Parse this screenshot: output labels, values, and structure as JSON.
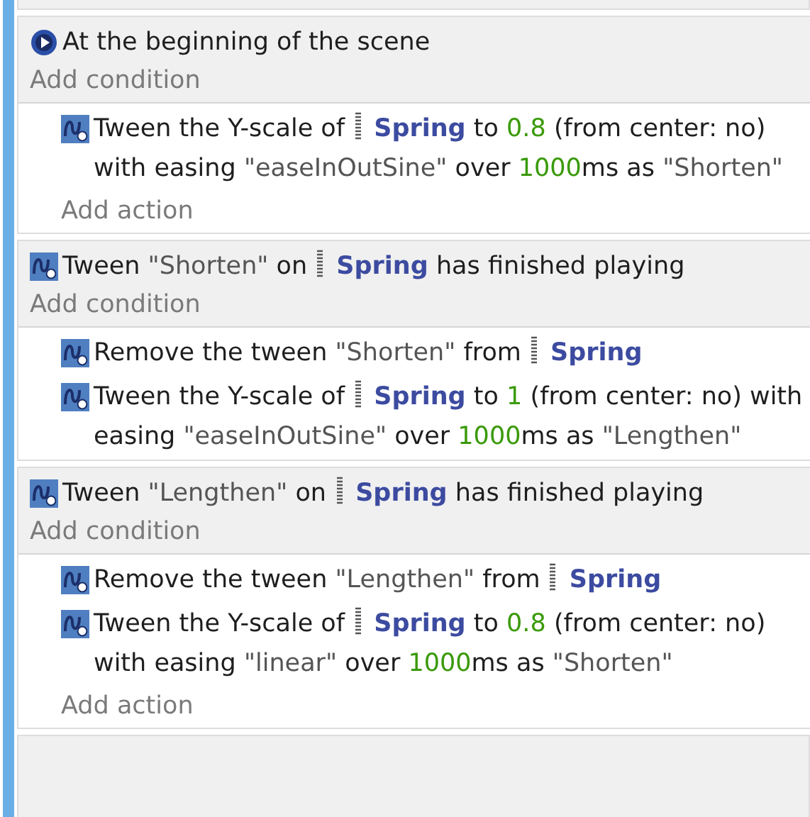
{
  "events": [
    {
      "condition": {
        "kind": "scene-start",
        "parts": [
          {
            "kind": "plain",
            "text": "At the beginning of the scene"
          }
        ]
      },
      "add_condition": "Add condition",
      "actions": [
        {
          "parts": [
            {
              "kind": "plain",
              "text": "Tween the Y-scale of "
            },
            {
              "kind": "object",
              "text": "Spring"
            },
            {
              "kind": "plain",
              "text": " to "
            },
            {
              "kind": "number",
              "text": "0.8"
            },
            {
              "kind": "plain",
              "text": " (from center: no) with easing "
            },
            {
              "kind": "string",
              "text": "\"easeInOutSine\""
            },
            {
              "kind": "plain",
              "text": " over "
            },
            {
              "kind": "number",
              "text": "1000"
            },
            {
              "kind": "plain",
              "text": "ms as "
            },
            {
              "kind": "string",
              "text": "\"Shorten\""
            }
          ]
        }
      ],
      "add_action": "Add action"
    },
    {
      "condition": {
        "kind": "tween-finished",
        "parts": [
          {
            "kind": "plain",
            "text": "Tween "
          },
          {
            "kind": "string",
            "text": "\"Shorten\""
          },
          {
            "kind": "plain",
            "text": " on "
          },
          {
            "kind": "object",
            "text": "Spring"
          },
          {
            "kind": "plain",
            "text": " has finished playing"
          }
        ]
      },
      "add_condition": "Add condition",
      "actions": [
        {
          "parts": [
            {
              "kind": "plain",
              "text": "Remove the tween "
            },
            {
              "kind": "string",
              "text": "\"Shorten\""
            },
            {
              "kind": "plain",
              "text": " from "
            },
            {
              "kind": "object",
              "text": "Spring"
            }
          ]
        },
        {
          "parts": [
            {
              "kind": "plain",
              "text": "Tween the Y-scale of "
            },
            {
              "kind": "object",
              "text": "Spring"
            },
            {
              "kind": "plain",
              "text": " to "
            },
            {
              "kind": "number",
              "text": "1"
            },
            {
              "kind": "plain",
              "text": " (from center: no) with easing "
            },
            {
              "kind": "string",
              "text": "\"easeInOutSine\""
            },
            {
              "kind": "plain",
              "text": " over "
            },
            {
              "kind": "number",
              "text": "1000"
            },
            {
              "kind": "plain",
              "text": "ms as "
            },
            {
              "kind": "string",
              "text": "\"Lengthen\""
            }
          ]
        }
      ]
    },
    {
      "condition": {
        "kind": "tween-finished",
        "parts": [
          {
            "kind": "plain",
            "text": "Tween "
          },
          {
            "kind": "string",
            "text": "\"Lengthen\""
          },
          {
            "kind": "plain",
            "text": " on "
          },
          {
            "kind": "object",
            "text": "Spring"
          },
          {
            "kind": "plain",
            "text": " has finished playing"
          }
        ]
      },
      "add_condition": "Add condition",
      "actions": [
        {
          "parts": [
            {
              "kind": "plain",
              "text": "Remove the tween "
            },
            {
              "kind": "string",
              "text": "\"Lengthen\""
            },
            {
              "kind": "plain",
              "text": " from "
            },
            {
              "kind": "object",
              "text": "Spring"
            }
          ]
        },
        {
          "parts": [
            {
              "kind": "plain",
              "text": "Tween the Y-scale of "
            },
            {
              "kind": "object",
              "text": "Spring"
            },
            {
              "kind": "plain",
              "text": " to "
            },
            {
              "kind": "number",
              "text": "0.8"
            },
            {
              "kind": "plain",
              "text": " (from center: no) with easing "
            },
            {
              "kind": "string",
              "text": "\"linear\""
            },
            {
              "kind": "plain",
              "text": " over "
            },
            {
              "kind": "number",
              "text": "1000"
            },
            {
              "kind": "plain",
              "text": "ms as "
            },
            {
              "kind": "string",
              "text": "\"Shorten\""
            }
          ]
        }
      ],
      "add_action": "Add action"
    }
  ]
}
